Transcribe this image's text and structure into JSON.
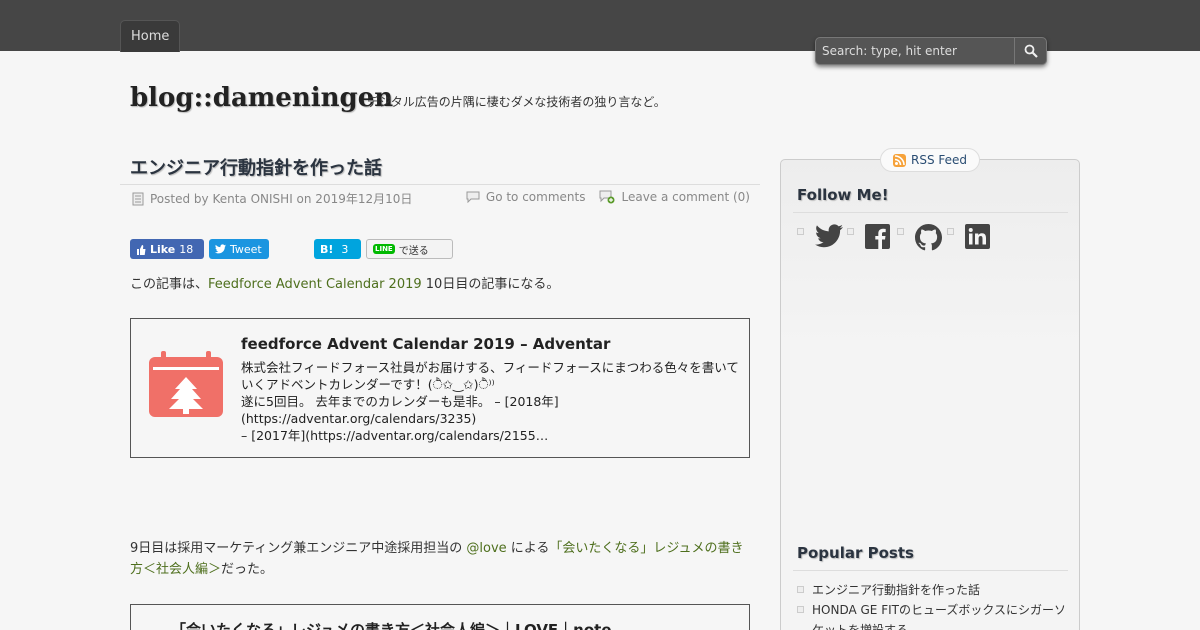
{
  "nav": {
    "home": "Home"
  },
  "search": {
    "placeholder": "Search: type, hit enter"
  },
  "site": {
    "title": "blog::dameningen",
    "description": "デジタル広告の片隅に棲むダメな技術者の独り言など。"
  },
  "post": {
    "title": "エンジニア行動指針を作った話",
    "meta_posted": "Posted by Kenta ONISHI on 2019年12月10日",
    "go_comments": "Go to comments",
    "leave_comment": "Leave a comment (0)"
  },
  "share": {
    "fb_label": "Like",
    "fb_count": "18",
    "tw_label": "Tweet",
    "hb_label": "B!",
    "hb_count": "3",
    "line_badge": "LINE",
    "line_label": "で送る"
  },
  "intro": {
    "before": "この記事は、",
    "link": "Feedforce Advent Calendar 2019",
    "after": " 10日目の記事になる。"
  },
  "card": {
    "title": "feedforce Advent Calendar 2019 – Adventar",
    "desc1": "株式会社フィードフォース社員がお届けする、フィードフォースにまつわる色々を書いていくアドベントカレンダーです！(ੈ✩‿✩)ੈ⁾⁾",
    "desc2": "遂に5回目。 去年までのカレンダーも是非。 – [2018年](https://adventar.org/calendars/3235)",
    "desc3": "– [2017年](https://adventar.org/calendars/2155…"
  },
  "day9": {
    "before": "9日目は採用マーケティング兼エンジニア中途採用担当の ",
    "mention": "@love",
    "middle": " による",
    "link": "「会いたくなる」レジュメの書き方＜社会人編＞",
    "after": "だった。"
  },
  "card2": {
    "title": "「会いたくなる」レジュメの書き方＜社会人編＞｜LOVE｜note"
  },
  "sidebar": {
    "rss": "RSS Feed",
    "follow_title": "Follow Me!",
    "popular_title": "Popular Posts",
    "popular": [
      "エンジニア行動指針を作った話",
      "HONDA GE FITのヒューズボックスにシガーソケットを増設する"
    ]
  },
  "colors": {
    "topbar": "#464646",
    "link": "#4e6f1d",
    "calendar_icon": "#f07068"
  },
  "icons": [
    "search-icon",
    "document-icon",
    "comment-icon",
    "comment-add-icon",
    "facebook-icon",
    "twitter-icon",
    "hatena-icon",
    "rss-icon",
    "github-icon",
    "linkedin-icon",
    "calendar-tree-icon"
  ]
}
